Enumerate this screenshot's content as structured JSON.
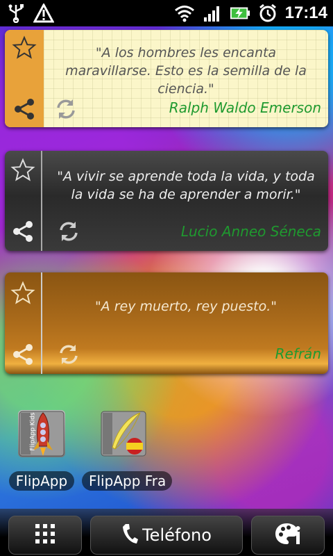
{
  "status_bar": {
    "clock": "17:14",
    "icons": [
      "usb-icon",
      "warning-icon",
      "wifi-icon",
      "signal-icon",
      "battery-charging-icon",
      "alarm-icon"
    ]
  },
  "widgets": [
    {
      "quote": "\"A los hombres les encanta maravillarse. Esto es la semilla de la ciencia.\"",
      "author": "Ralph Waldo Emerson",
      "style": "paper"
    },
    {
      "quote": "\"A vivir se aprende toda la vida, y toda la vida se ha de aprender a morir.\"",
      "author": "Lucio Anneo Séneca",
      "style": "dark-wood"
    },
    {
      "quote": "\"A rey muerto, rey puesto.\"",
      "author": "Refrán",
      "style": "light-wood"
    }
  ],
  "apps": [
    {
      "label": "FlipApp",
      "icon": "rocket-icon",
      "badge": "FlipApp Kids"
    },
    {
      "label": "FlipApp Fra",
      "icon": "quill-icon"
    }
  ],
  "dock": {
    "phone_label": "Teléfono",
    "left_icon": "app-grid-icon",
    "right_icon": "personalize-icon"
  },
  "colors": {
    "author_green": "#1f9a2f",
    "orange_side": "#e8a23a"
  }
}
